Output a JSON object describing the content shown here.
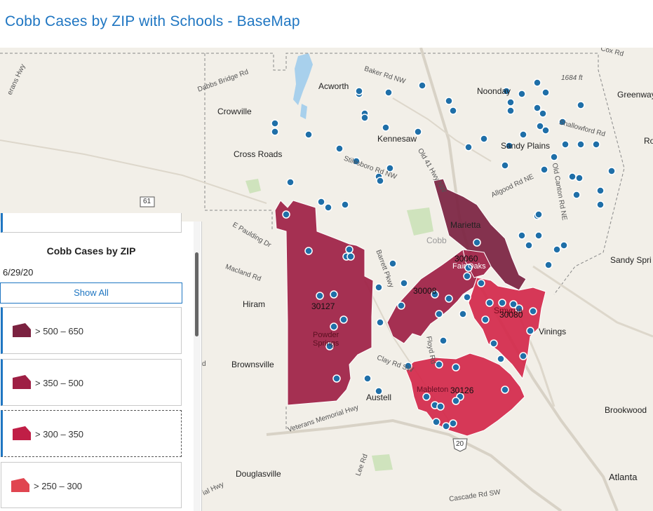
{
  "header": {
    "title": "Cobb Cases by ZIP with Schools - BaseMap"
  },
  "map": {
    "places": [
      "Acworth",
      "Noonday",
      "Greenway",
      "Crowville",
      "Kennesaw",
      "Sandy Plains",
      "Cross Roads",
      "Marietta",
      "Cobb",
      "Hiram",
      "Powder Springs",
      "Fair Oaks",
      "Smyrna",
      "Vinings",
      "Sandy Spri",
      "Brownsville",
      "Austell",
      "Mableton",
      "Brookwood",
      "Douglasville",
      "Atlanta",
      "Ro"
    ],
    "roads": [
      "Baker Rd NW",
      "Dabbs Bridge Rd",
      "Stilesboro Rd NW",
      "Old 41 Hwy NW",
      "Allgood Rd NE",
      "Old Canton Rd NE",
      "Shallowford Rd",
      "E Paulding Dr",
      "Macland Rd",
      "Barrett Pkwy",
      "Clay Rd SW",
      "Floyd Rd",
      "Veterans Memorial Hwy",
      "Lee Rd",
      "Cascade Rd SW",
      "Cox Rd",
      "1684 ft",
      "erans Hwy",
      "ial Hwy",
      "d"
    ],
    "shields": [
      "61",
      "20"
    ],
    "zip_labels": [
      "30127",
      "30008",
      "30080",
      "30126",
      "30060"
    ]
  },
  "legend": {
    "title": "Cobb Cases by ZIP",
    "date": "6/29/20",
    "show_all": "Show All",
    "classes": [
      {
        "label": "> 500 – 650",
        "color": "#7b2240"
      },
      {
        "label": "> 350 – 500",
        "color": "#9e1f44"
      },
      {
        "label": "> 300 – 350",
        "color": "#c01e46"
      },
      {
        "label": "> 250 – 300",
        "color": "#e04550"
      }
    ]
  }
}
